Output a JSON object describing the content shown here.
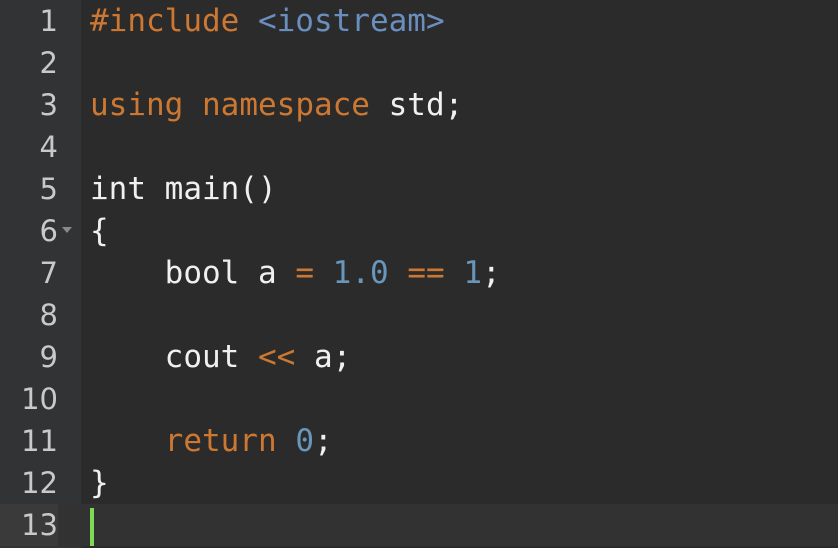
{
  "editor": {
    "cursor_color": "#7ed957",
    "lines": [
      {
        "number": "1",
        "tokens": [
          {
            "type": "pre",
            "text": "#include"
          },
          {
            "type": "plain",
            "text": " "
          },
          {
            "type": "inc",
            "text": "<iostream>"
          }
        ]
      },
      {
        "number": "2",
        "tokens": []
      },
      {
        "number": "3",
        "tokens": [
          {
            "type": "kw",
            "text": "using"
          },
          {
            "type": "plain",
            "text": " "
          },
          {
            "type": "kw",
            "text": "namespace"
          },
          {
            "type": "plain",
            "text": " std;"
          }
        ]
      },
      {
        "number": "4",
        "tokens": []
      },
      {
        "number": "5",
        "tokens": [
          {
            "type": "plain",
            "text": "int main()"
          }
        ]
      },
      {
        "number": "6",
        "fold": true,
        "tokens": [
          {
            "type": "plain",
            "text": "{"
          }
        ]
      },
      {
        "number": "7",
        "tokens": [
          {
            "type": "plain",
            "text": "    bool a "
          },
          {
            "type": "op",
            "text": "="
          },
          {
            "type": "plain",
            "text": " "
          },
          {
            "type": "num",
            "text": "1.0"
          },
          {
            "type": "plain",
            "text": " "
          },
          {
            "type": "op",
            "text": "=="
          },
          {
            "type": "plain",
            "text": " "
          },
          {
            "type": "num",
            "text": "1"
          },
          {
            "type": "plain",
            "text": ";"
          }
        ]
      },
      {
        "number": "8",
        "tokens": []
      },
      {
        "number": "9",
        "tokens": [
          {
            "type": "plain",
            "text": "    cout "
          },
          {
            "type": "op",
            "text": "<<"
          },
          {
            "type": "plain",
            "text": " a;"
          }
        ]
      },
      {
        "number": "10",
        "tokens": []
      },
      {
        "number": "11",
        "tokens": [
          {
            "type": "plain",
            "text": "    "
          },
          {
            "type": "kw",
            "text": "return"
          },
          {
            "type": "plain",
            "text": " "
          },
          {
            "type": "num",
            "text": "0"
          },
          {
            "type": "plain",
            "text": ";"
          }
        ]
      },
      {
        "number": "12",
        "tokens": [
          {
            "type": "plain",
            "text": "}"
          }
        ]
      },
      {
        "number": "13",
        "current": true,
        "tokens": []
      }
    ]
  }
}
